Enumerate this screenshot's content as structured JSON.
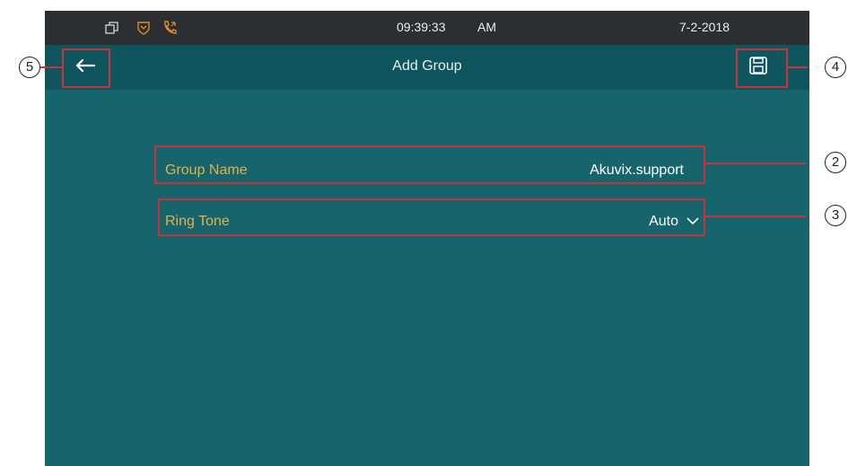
{
  "status_bar": {
    "time": "09:39:33",
    "ampm": "AM",
    "date": "7-2-2018",
    "icons": [
      "window-icon",
      "shield-icon",
      "phone-icon"
    ],
    "icon_color": "#e28a2d"
  },
  "header": {
    "title": "Add Group",
    "back_icon": "arrow-left-icon",
    "save_icon": "save-disk-icon"
  },
  "form": {
    "group_name": {
      "label": "Group Name",
      "value": "Akuvix.support"
    },
    "ring_tone": {
      "label": "Ring Tone",
      "value": "Auto"
    }
  },
  "callouts": {
    "back": "5",
    "save": "4",
    "group_name": "2",
    "ring_tone": "3"
  },
  "colors": {
    "background": "#16646c",
    "title_bar": "#0f555d",
    "status_bar": "#2b2f31",
    "label": "#e2b04c",
    "callout": "#c8323c"
  }
}
